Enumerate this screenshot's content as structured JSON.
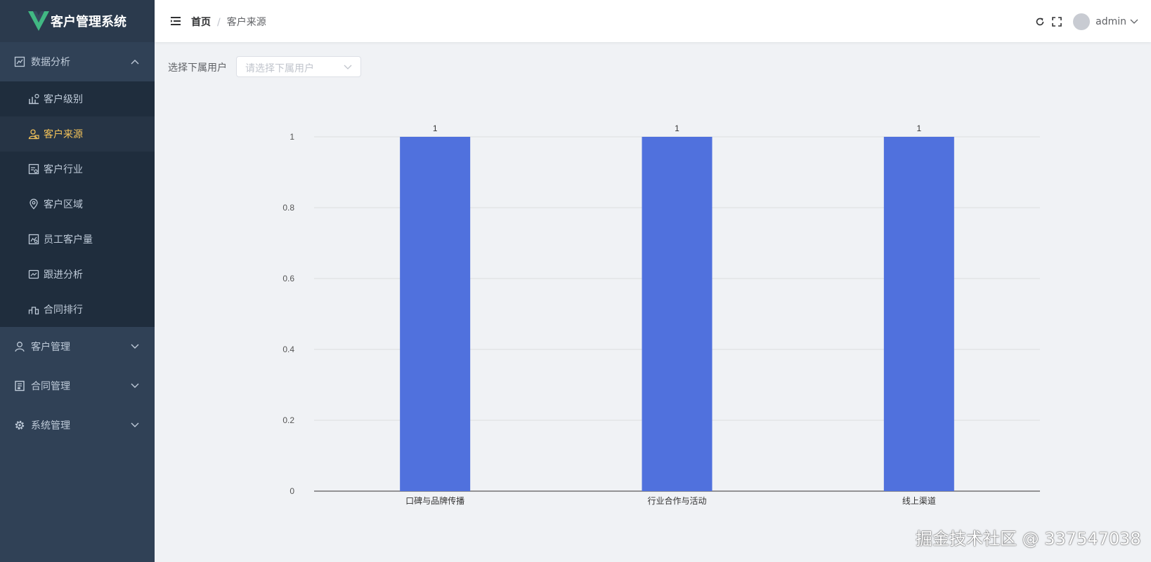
{
  "app": {
    "title": "客户管理系统",
    "brand_color": "#41b883"
  },
  "sidebar": {
    "groups": [
      {
        "label": "数据分析",
        "icon": "chart-analysis-icon",
        "expanded": true
      },
      {
        "label": "客户管理",
        "icon": "user-icon",
        "expanded": false
      },
      {
        "label": "合同管理",
        "icon": "contract-icon",
        "expanded": false
      },
      {
        "label": "系统管理",
        "icon": "gear-icon",
        "expanded": false
      }
    ],
    "analysis_items": [
      {
        "label": "客户级别",
        "icon": "level-chart-icon",
        "active": false
      },
      {
        "label": "客户来源",
        "icon": "source-icon",
        "active": true
      },
      {
        "label": "客户行业",
        "icon": "industry-icon",
        "active": false
      },
      {
        "label": "客户区域",
        "icon": "location-icon",
        "active": false
      },
      {
        "label": "员工客户量",
        "icon": "report-icon",
        "active": false
      },
      {
        "label": "跟进分析",
        "icon": "follow-up-icon",
        "active": false
      },
      {
        "label": "合同排行",
        "icon": "podium-icon",
        "active": false
      }
    ],
    "active_color": "#f4c35a"
  },
  "header": {
    "breadcrumb": {
      "home": "首页",
      "separator": "/",
      "current": "客户来源"
    },
    "user": {
      "name": "admin"
    }
  },
  "filter": {
    "label": "选择下属用户",
    "placeholder": "请选择下属用户"
  },
  "chart_data": {
    "type": "bar",
    "categories": [
      "口碑与品牌传播",
      "行业合作与活动",
      "线上渠道"
    ],
    "values": [
      1,
      1,
      1
    ],
    "ylim": [
      0,
      1
    ],
    "yticks": [
      "0",
      "0.2",
      "0.4",
      "0.6",
      "0.8",
      "1"
    ],
    "data_labels": true,
    "grid": true,
    "color": "#5071dd"
  },
  "watermark": "掘金技术社区 @ 337547038"
}
